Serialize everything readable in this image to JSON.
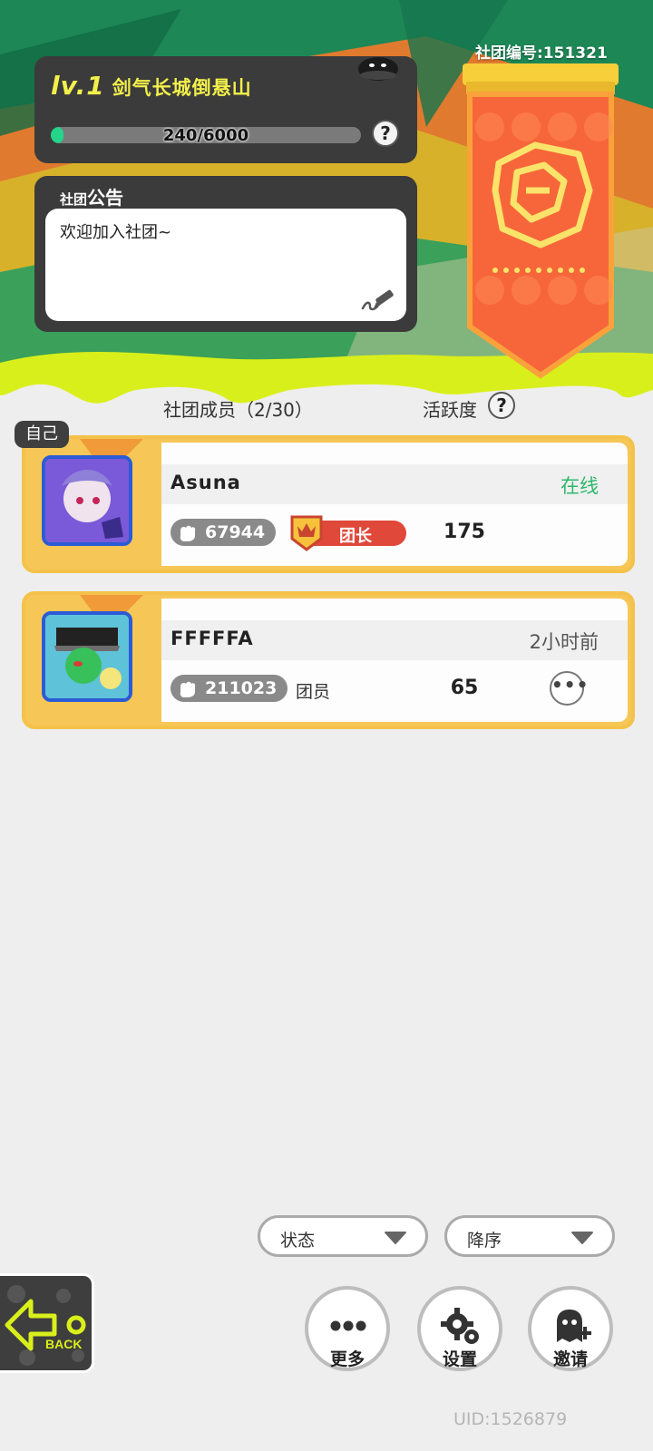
{
  "header": {
    "level_label": "lv.1",
    "club_name": "剑气长城倒悬山",
    "xp_text": "240/6000",
    "xp_progress": 0.04,
    "club_id": "社团编号:151321",
    "notice_title_small": "社团",
    "notice_title_big": "公告",
    "notice_text": "欢迎加入社团~"
  },
  "members_header": {
    "title": "社团成员（2/30）",
    "activity": "活跃度"
  },
  "members": [
    {
      "self_tag": "自己",
      "name": "Asuna",
      "status": "在线",
      "status_color": "#2fb86b",
      "power": "67944",
      "role": "团长",
      "activity": "175"
    },
    {
      "name": "FFFFFA",
      "status": "2小时前",
      "status_color": "#555555",
      "power": "211023",
      "role": "团员",
      "activity": "65"
    }
  ],
  "filters": {
    "status_label": "状态",
    "order_label": "降序"
  },
  "actions": {
    "back_label": "BACK",
    "more_label": "更多",
    "settings_label": "设置",
    "invite_label": "邀请"
  },
  "footer": {
    "uid": "UID:1526879"
  },
  "icons": [
    "help-icon",
    "edit-icon",
    "fist-icon",
    "crown-shield-icon",
    "chevron-down-icon",
    "back-arrow-icon",
    "ellipsis-icon",
    "gear-icon",
    "add-user-icon",
    "mascot-icon",
    "club-emblem-icon"
  ],
  "colors": {
    "accent_green": "#25d38a",
    "header_green": "#1f8a5a",
    "lime": "#d9ef1b",
    "banner_orange": "#f47a3a",
    "gold": "#f4c24a",
    "leader_red": "#e0483a"
  }
}
